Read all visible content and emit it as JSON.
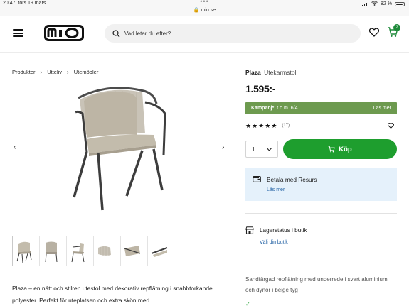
{
  "status_bar": {
    "time": "20:47",
    "date": "tors 19 mars",
    "dots": "•••",
    "url": "mio.se",
    "battery": "82 %"
  },
  "header": {
    "logo": "mio",
    "search_placeholder": "Vad letar du efter?",
    "cart_count": "2",
    "icons": [
      "menu-icon",
      "search-icon",
      "heart-icon",
      "cart-icon"
    ]
  },
  "breadcrumb": [
    "Produkter",
    "Utteliv",
    "Utemöbler"
  ],
  "product": {
    "name": "Plaza",
    "subtitle": "Utekarmstol",
    "price": "1.595:-",
    "campaign_label": "Kampanj*",
    "campaign_date": "t.o.m. 6/4",
    "campaign_more": "Läs mer",
    "rating_stars": 5,
    "rating_count": "(17)",
    "quantity": "1",
    "buy_label": "Köp",
    "resurs_title": "Betala med Resurs",
    "resurs_link": "Läs mer",
    "store_title": "Lagerstatus i butik",
    "store_link": "Välj din butik",
    "note": "Sandfärgad repflätning med underrede i svart aluminium och dynor i beige tyg",
    "bullet_peek": "✓"
  },
  "description": "Plaza – en nätt och stilren utestol med dekorativ repflätning i snabbtorkande polyester. Perfekt för uteplatsen och extra skön med",
  "gallery": {
    "prev": "‹",
    "next": "›",
    "thumb_count": 6
  },
  "colors": {
    "buy_green": "#1e9e2e",
    "campaign_green": "#6d9a4f",
    "resurs_bg": "#e5f1fb",
    "link_blue": "#1f5fa3"
  }
}
